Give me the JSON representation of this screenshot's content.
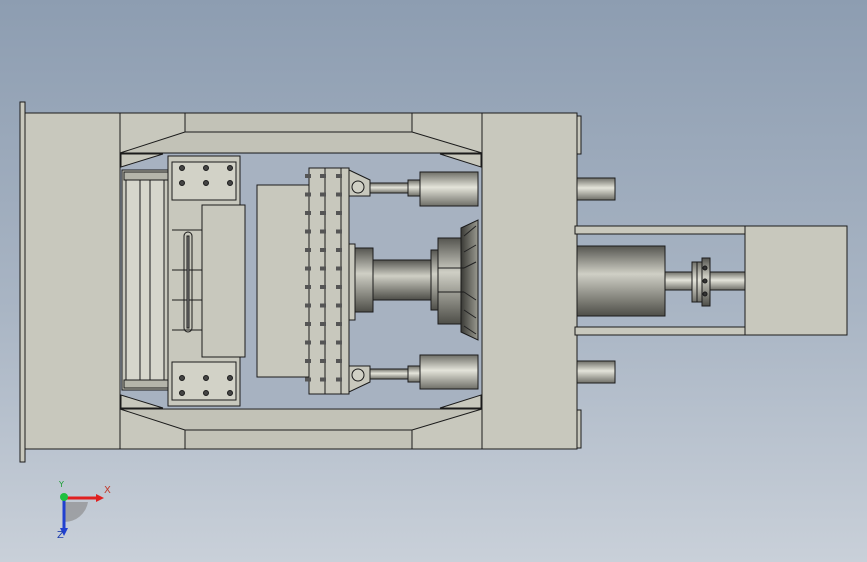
{
  "colors": {
    "background_top": "#8d9db1",
    "background_bottom": "#c9d0d9",
    "part_fill": "#c8c8bd",
    "part_shadow": "#9a9a90",
    "edge": "#1b1b1b",
    "cylinder_dark": "#6f6f68",
    "cylinder_light": "#e4e4da",
    "axis_x": "#e02020",
    "axis_y": "#20c040",
    "axis_z": "#2040d0"
  },
  "triad": {
    "x_label": "X",
    "y_label": "Y",
    "z_label": "Z"
  },
  "parts": {
    "main_frame": "main-frame",
    "moving_platen": "moving-platen",
    "mold_block": "mold-block",
    "flange_plate": "flange-plate",
    "main_ram": "main-ram",
    "guide_cylinders": "guide-cylinders",
    "hydraulic_cylinder": "hydraulic-cylinder",
    "tail_block": "tail-block"
  }
}
